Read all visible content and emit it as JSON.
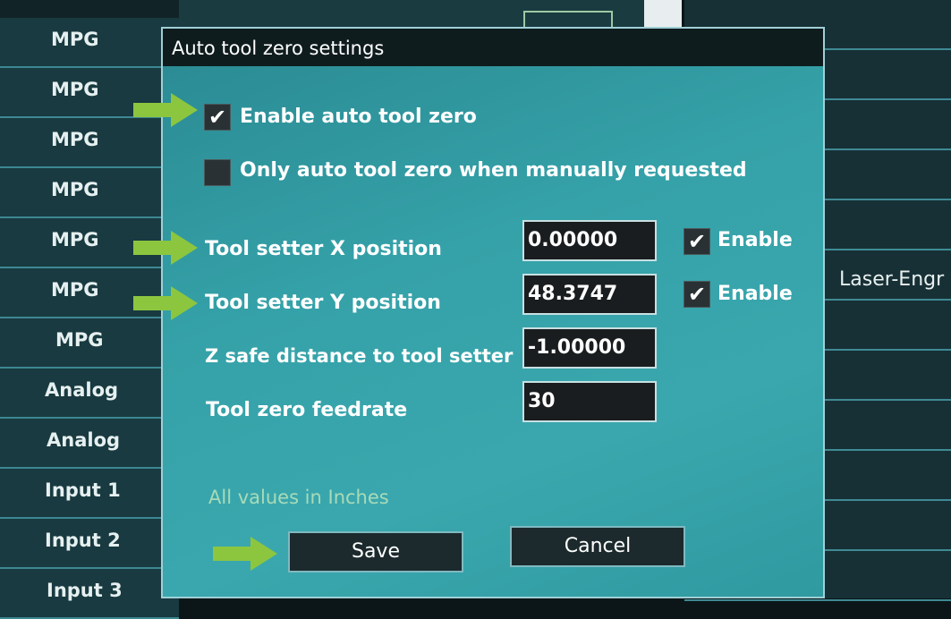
{
  "background": {
    "left_rows": [
      "MPG",
      "MPG",
      "MPG",
      "MPG",
      "MPG",
      "MPG",
      "MPG",
      "Analog",
      "Analog",
      "Input 1",
      "Input 2",
      "Input 3"
    ],
    "right_label": "Laser-Engr"
  },
  "dialog": {
    "title": "Auto tool zero settings",
    "enable_auto_tool_zero": {
      "label": "Enable auto tool zero",
      "checked": true,
      "mark": "✔"
    },
    "only_manual": {
      "label": "Only auto tool zero when manually requested",
      "checked": false
    },
    "fields": {
      "x_position": {
        "label": "Tool setter X position",
        "value": "0.00000",
        "enable_label": "Enable",
        "enable_checked": true
      },
      "y_position": {
        "label": "Tool setter Y position",
        "value": "48.3747",
        "enable_label": "Enable",
        "enable_checked": true
      },
      "z_safe": {
        "label": "Z safe distance to tool setter",
        "value": "-1.00000"
      },
      "feedrate": {
        "label": "Tool zero feedrate",
        "value": "30"
      }
    },
    "check_mark": "✔",
    "units_note": "All values in Inches",
    "buttons": {
      "save": "Save",
      "cancel": "Cancel"
    }
  },
  "annotation_color": "#8cc63f"
}
